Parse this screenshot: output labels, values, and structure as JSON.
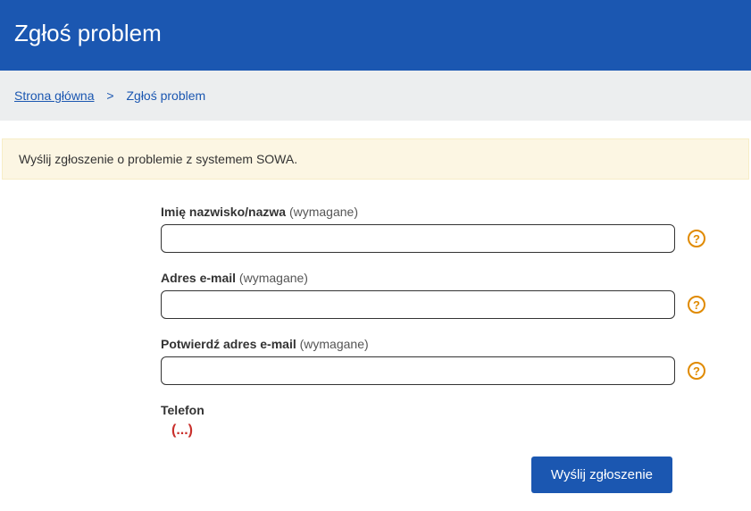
{
  "header": {
    "title": "Zgłoś problem"
  },
  "breadcrumb": {
    "home": "Strona główna",
    "sep": ">",
    "current": "Zgłoś problem"
  },
  "alert": {
    "text": "Wyślij zgłoszenie o problemie z systemem SOWA."
  },
  "form": {
    "name": {
      "label_bold": "Imię nazwisko/nazwa",
      "label_req": " (wymagane)",
      "value": ""
    },
    "email": {
      "label_bold": "Adres e-mail",
      "label_req": " (wymagane)",
      "value": ""
    },
    "email_confirm": {
      "label_bold": "Potwierdź adres e-mail",
      "label_req": " (wymagane)",
      "value": ""
    },
    "phone": {
      "label_bold": "Telefon",
      "ellipsis": "(...)"
    },
    "help_glyph": "?",
    "submit": "Wyślij zgłoszenie"
  }
}
